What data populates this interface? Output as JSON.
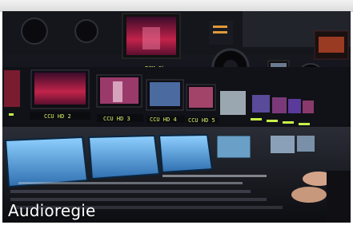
{
  "caption": "Audioregie",
  "monitor_labels": {
    "ccu2": "CCU HD 2",
    "ccu3": "CCU HD 3",
    "ccu4": "CCU HD 4",
    "ccu5": "CCU HD 5",
    "pgm": "PGM Show"
  },
  "colors": {
    "frame_border": "#dcdcdc",
    "console_blue": "#5aa7e0",
    "tally_green": "#c6f04a",
    "stage_red": "#c2234a"
  }
}
